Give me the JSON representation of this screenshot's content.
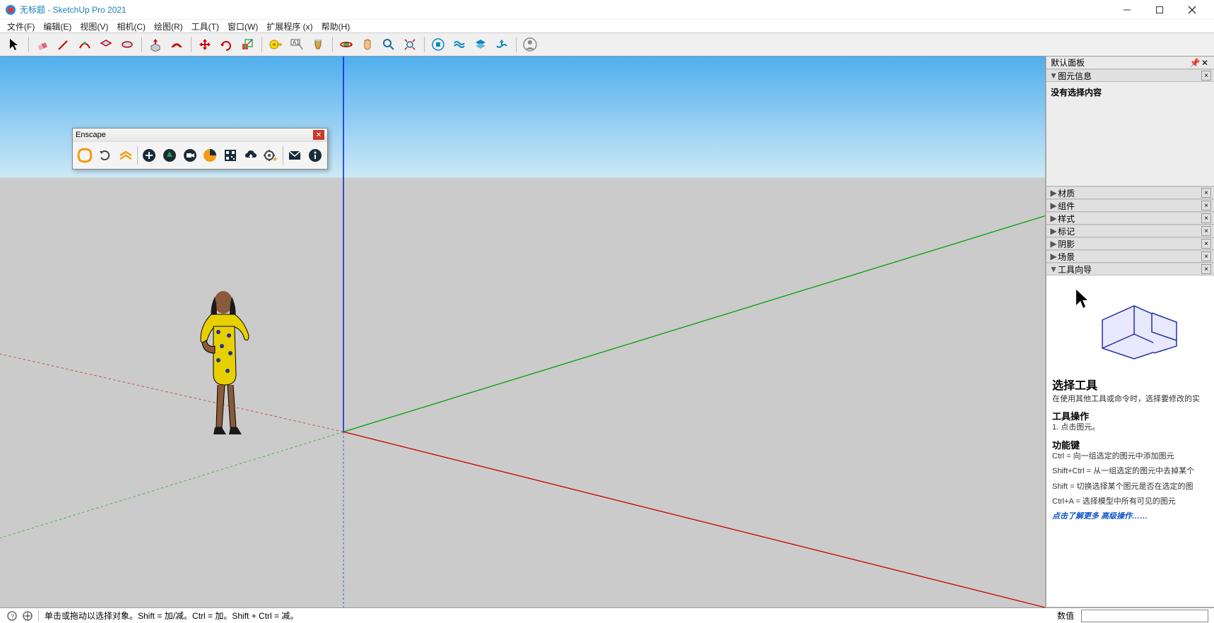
{
  "title": "无标题 - SketchUp Pro 2021",
  "menu": [
    "文件(F)",
    "编辑(E)",
    "视图(V)",
    "相机(C)",
    "绘图(R)",
    "工具(T)",
    "窗口(W)",
    "扩展程序 (x)",
    "帮助(H)"
  ],
  "enscape": {
    "title": "Enscape"
  },
  "tray": {
    "title": "默认面板",
    "entity_info": {
      "label": "图元信息",
      "body": "没有选择内容"
    },
    "panels": [
      "材质",
      "组件",
      "样式",
      "标记",
      "阴影",
      "场景"
    ],
    "instructor": {
      "label": "工具向导",
      "heading": "选择工具",
      "desc": "在使用其他工具或命令时，选择要修改的实",
      "op_title": "工具操作",
      "op_step": "1. 点击图元。",
      "fn_title": "功能键",
      "fn_lines": [
        "Ctrl = 向一组选定的图元中添加图元",
        "Shift+Ctrl = 从一组选定的图元中去掉某个",
        "Shift = 切换选择某个图元是否在选定的图",
        "Ctrl+A = 选择模型中所有可见的图元"
      ],
      "more": "点击了解更多 高级操作……"
    }
  },
  "statusbar": {
    "hint": "单击或拖动以选择对象。Shift = 加/减。Ctrl = 加。Shift + Ctrl = 减。",
    "vcb_label": "数值"
  }
}
